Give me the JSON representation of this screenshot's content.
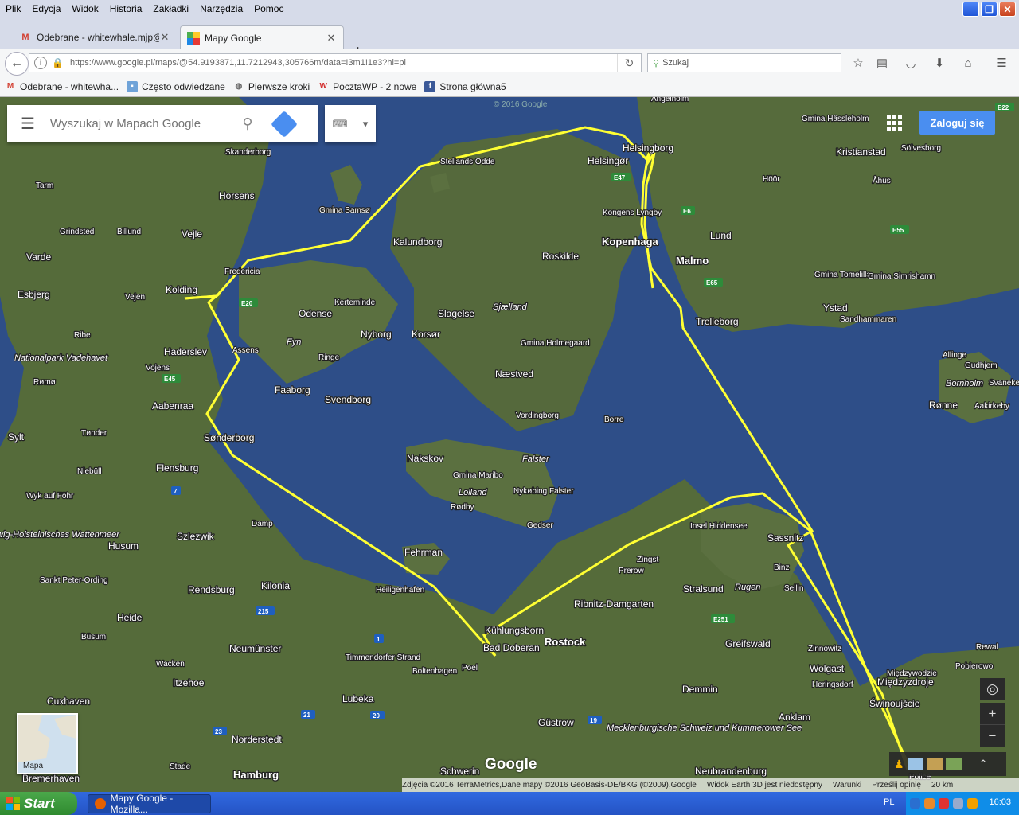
{
  "menu": [
    "Plik",
    "Edycja",
    "Widok",
    "Historia",
    "Zakładki",
    "Narzędzia",
    "Pomoc"
  ],
  "tabs": [
    {
      "label": "Odebrane - whitewhale.mjp@...",
      "icon": "gmail-icon"
    },
    {
      "label": "Mapy Google",
      "icon": "google-maps-icon"
    }
  ],
  "address": {
    "url": "https://www.google.pl/maps/@54.9193871,11.7212943,305766m/data=!3m1!1e3?hl=pl"
  },
  "browser_search": {
    "placeholder": "Szukaj"
  },
  "bookmarks": [
    {
      "label": "Odebrane - whitewha..."
    },
    {
      "label": "Często odwiedzane"
    },
    {
      "label": "Pierwsze kroki"
    },
    {
      "label": "PocztaWP - 2 nowe"
    },
    {
      "label": "Strona główna5"
    }
  ],
  "maps": {
    "search_placeholder": "Wyszukaj w Mapach Google",
    "signin": "Zaloguj się",
    "minimap_label": "Mapa",
    "logo": "Google",
    "attribution": [
      "Zdjęcia ©2016 TerraMetrics,Dane mapy ©2016 GeoBasis-DE/BKG (©2009),Google",
      "Widok Earth 3D jest niedostępny",
      "Warunki",
      "Prześlij opinię",
      "20 km"
    ],
    "watermark": "© 2016 Google",
    "route_color": "#ffff33",
    "places": [
      "Skanderborg",
      "Horsens",
      "Tarm",
      "Grindsted",
      "Billund",
      "Vejle",
      "Varde",
      "Esbjerg",
      "Vejen",
      "Kolding",
      "Fredericia",
      "Ribe",
      "Haderslev",
      "Vojens",
      "Nationalpark Vadehavet",
      "Rømø",
      "Aabenraa",
      "Tønder",
      "Sylt",
      "Niebüll",
      "Flensburg",
      "Wyk auf Föhr",
      "wig-Holsteinisches Wattenmeer",
      "Husum",
      "Szlezwik",
      "Sankt Peter-Ording",
      "Heide",
      "Büsum",
      "Rendsburg",
      "Neumünster",
      "Kilonia",
      "Wacken",
      "Itzehoe",
      "Cuxhaven",
      "Bremerhaven",
      "Stade",
      "Norderstedt",
      "Hamburg",
      "Lubeka",
      "Timmendorfer Strand",
      "Heiligenhafen",
      "Fehrman",
      "Odense",
      "Kerteminde",
      "Nyborg",
      "Fyn",
      "Ringe",
      "Faaborg",
      "Svendborg",
      "Assens",
      "Sønderborg",
      "Damp",
      "Kalundborg",
      "Stellands Odde",
      "Gmina Samsø",
      "Slagelse",
      "Korsør",
      "Sjælland",
      "Roskilde",
      "Kopenhaga",
      "Gmina Holmegaard",
      "Næstved",
      "Vordingborg",
      "Borre",
      "Nakskov",
      "Falster",
      "Gmina Maribo",
      "Lolland",
      "Nykøbing Falster",
      "Rødby",
      "Gedser",
      "Helsingør",
      "Helsingborg",
      "Kongens Lyngby",
      "Malmo",
      "Lund",
      "Gmina Hässleholm",
      "Kristianstad",
      "Sölvesborg",
      "Höör",
      "Åhus",
      "Gmina Tomelilla",
      "Gmina Simrishamn",
      "Ystad",
      "Sandhammaren",
      "Trelleborg",
      "Allinge",
      "Gudhjem",
      "Bornholm",
      "Svaneke",
      "Rønne",
      "Aakirkeby",
      "Angelholm",
      "Insel Hiddensee",
      "Sassnitz",
      "Binz",
      "Sellin",
      "Rugen",
      "Stralsund",
      "Zingst",
      "Prerow",
      "Ribnitz-Damgarten",
      "Kühlungsborn",
      "Bad Doberan",
      "Rostock",
      "Boltenhagen",
      "Poel",
      "Greifswald",
      "Zinnowitz",
      "Wolgast",
      "Heringsdorf",
      "Międzywodzie",
      "Międzyzdroje",
      "Świnoujście",
      "Demmin",
      "Anklam",
      "Güstrow",
      "Mecklenburgische Schweiz und Kummerower See",
      "Schwerin",
      "Neubrandenburg",
      "Rewal",
      "Pobierowo",
      "Police"
    ],
    "roads": [
      "E45",
      "E20",
      "E47",
      "E6",
      "E65",
      "E22",
      "E55",
      "E251",
      "7",
      "215",
      "1",
      "21",
      "23",
      "20",
      "19"
    ]
  },
  "taskbar": {
    "start": "Start",
    "item": "Mapy Google - Mozilla...",
    "lang": "PL",
    "time": "16:03"
  }
}
